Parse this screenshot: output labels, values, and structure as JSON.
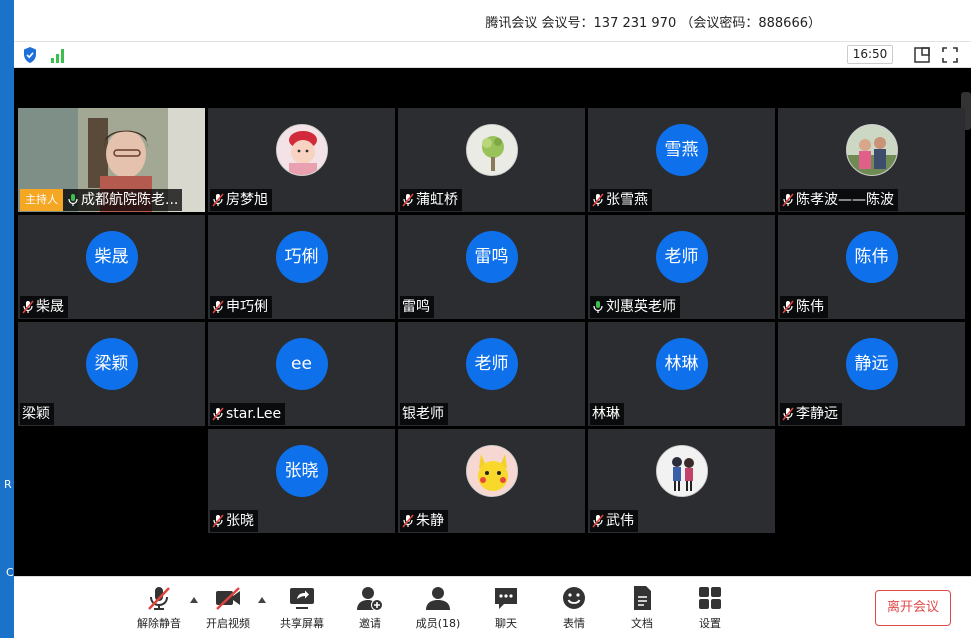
{
  "window": {
    "title": "腾讯会议 会议号：137 231 970 （会议密码：888666）",
    "time": "16:50"
  },
  "side_glyphs": {
    "r": "R",
    "c": "C"
  },
  "host_badge": "主持人",
  "participants": [
    {
      "name": "成都航院陈老...",
      "initials": "",
      "type": "video",
      "mic": "active"
    },
    {
      "name": "房梦旭",
      "initials": "",
      "type": "photo",
      "photo": "baby-photo-icon",
      "mic": "muted"
    },
    {
      "name": "蒲虹桥",
      "initials": "",
      "type": "photo",
      "photo": "plant-photo-icon",
      "mic": "muted"
    },
    {
      "name": "张雪燕",
      "initials": "雪燕",
      "type": "initials",
      "mic": "muted"
    },
    {
      "name": "陈孝波——陈波",
      "initials": "",
      "type": "photo",
      "photo": "family-photo-icon",
      "mic": "muted"
    },
    {
      "name": "柴晟",
      "initials": "柴晟",
      "type": "initials",
      "mic": "muted"
    },
    {
      "name": "申巧俐",
      "initials": "巧俐",
      "type": "initials",
      "mic": "muted"
    },
    {
      "name": "雷鸣",
      "initials": "雷鸣",
      "type": "initials",
      "mic": "none"
    },
    {
      "name": "刘惠英老师",
      "initials": "老师",
      "type": "initials",
      "mic": "active"
    },
    {
      "name": "陈伟",
      "initials": "陈伟",
      "type": "initials",
      "mic": "muted"
    },
    {
      "name": "梁颖",
      "initials": "梁颖",
      "type": "initials",
      "mic": "none"
    },
    {
      "name": "star.Lee",
      "initials": "ee",
      "type": "initials",
      "mic": "muted"
    },
    {
      "name": "银老师",
      "initials": "老师",
      "type": "initials",
      "mic": "none"
    },
    {
      "name": "林琳",
      "initials": "林琳",
      "type": "initials",
      "mic": "none"
    },
    {
      "name": "李静远",
      "initials": "静远",
      "type": "initials",
      "mic": "muted"
    },
    {
      "name": "张晓",
      "initials": "张晓",
      "type": "initials",
      "mic": "muted"
    },
    {
      "name": "朱静",
      "initials": "",
      "type": "photo",
      "photo": "pikachu-photo-icon",
      "mic": "muted"
    },
    {
      "name": "武伟",
      "initials": "",
      "type": "photo",
      "photo": "cartoon-couple-photo-icon",
      "mic": "muted"
    }
  ],
  "toolbar": {
    "unmute": "解除静音",
    "start_video": "开启视频",
    "share_screen": "共享屏幕",
    "invite": "邀请",
    "members": "成员(18)",
    "chat": "聊天",
    "reactions": "表情",
    "docs": "文档",
    "settings": "设置",
    "leave": "离开会议"
  },
  "colors": {
    "accent": "#0e71eb",
    "tile_bg": "#2b2d30",
    "host_badge": "#f5a623",
    "leave_red": "#e04a4a",
    "mute_red": "#e0443e",
    "mic_green": "#3cbf4c"
  }
}
